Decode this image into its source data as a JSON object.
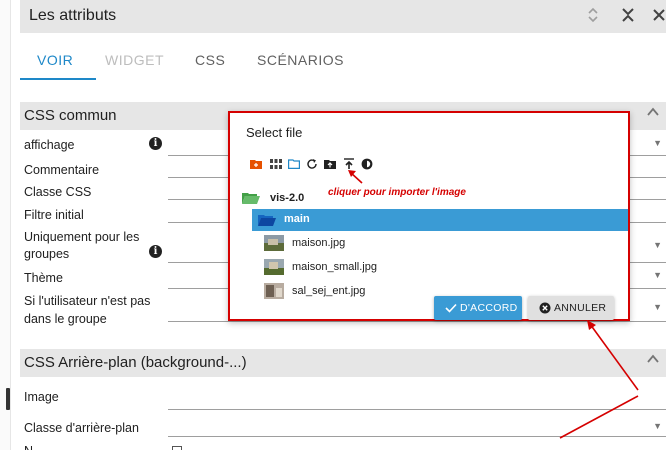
{
  "panel": {
    "title": "Les attributs",
    "icons": [
      "expand-collapse-icon",
      "compress-icon",
      "close-icon"
    ]
  },
  "tabs": [
    {
      "label": "VOIR",
      "state": "active"
    },
    {
      "label": "WIDGET",
      "state": "disabled"
    },
    {
      "label": "CSS",
      "state": "normal"
    },
    {
      "label": "SCÉNARIOS",
      "state": "normal"
    }
  ],
  "section_css_commun": {
    "title": "CSS commun",
    "rows": {
      "affichage": "affichage",
      "commentaire": "Commentaire",
      "classe_css": "Classe CSS",
      "filtre_initial": "Filtre initial",
      "groupes_line1": "Uniquement pour les",
      "groupes_line2": "groupes",
      "theme": "Thème",
      "hors_groupe_line1": "Si l'utilisateur n'est pas",
      "hors_groupe_line2": "dans le groupe"
    }
  },
  "section_background": {
    "title": "CSS Arrière-plan (background-...)",
    "rows": {
      "image": "Image",
      "classe": "Classe d'arrière-plan",
      "partial": "N"
    }
  },
  "dialog": {
    "title": "Select file",
    "toolbar_icons": [
      "add-folder-icon",
      "grid-view-icon",
      "folder-icon",
      "refresh-icon",
      "folder-upload-icon",
      "upload-icon",
      "brightness-icon"
    ],
    "annotation": "cliquer pour importer l'image",
    "root_folder": "vis-2.0",
    "selected_folder": "main",
    "files": [
      "maison.jpg",
      "maison_small.jpg",
      "sal_sej_ent.jpg"
    ],
    "ok_label": "D'ACCORD",
    "cancel_label": "ANNULER"
  },
  "colors": {
    "accent": "#3a9bd5",
    "annotation_red": "#d50000",
    "header_gray": "#e6e6e6"
  }
}
